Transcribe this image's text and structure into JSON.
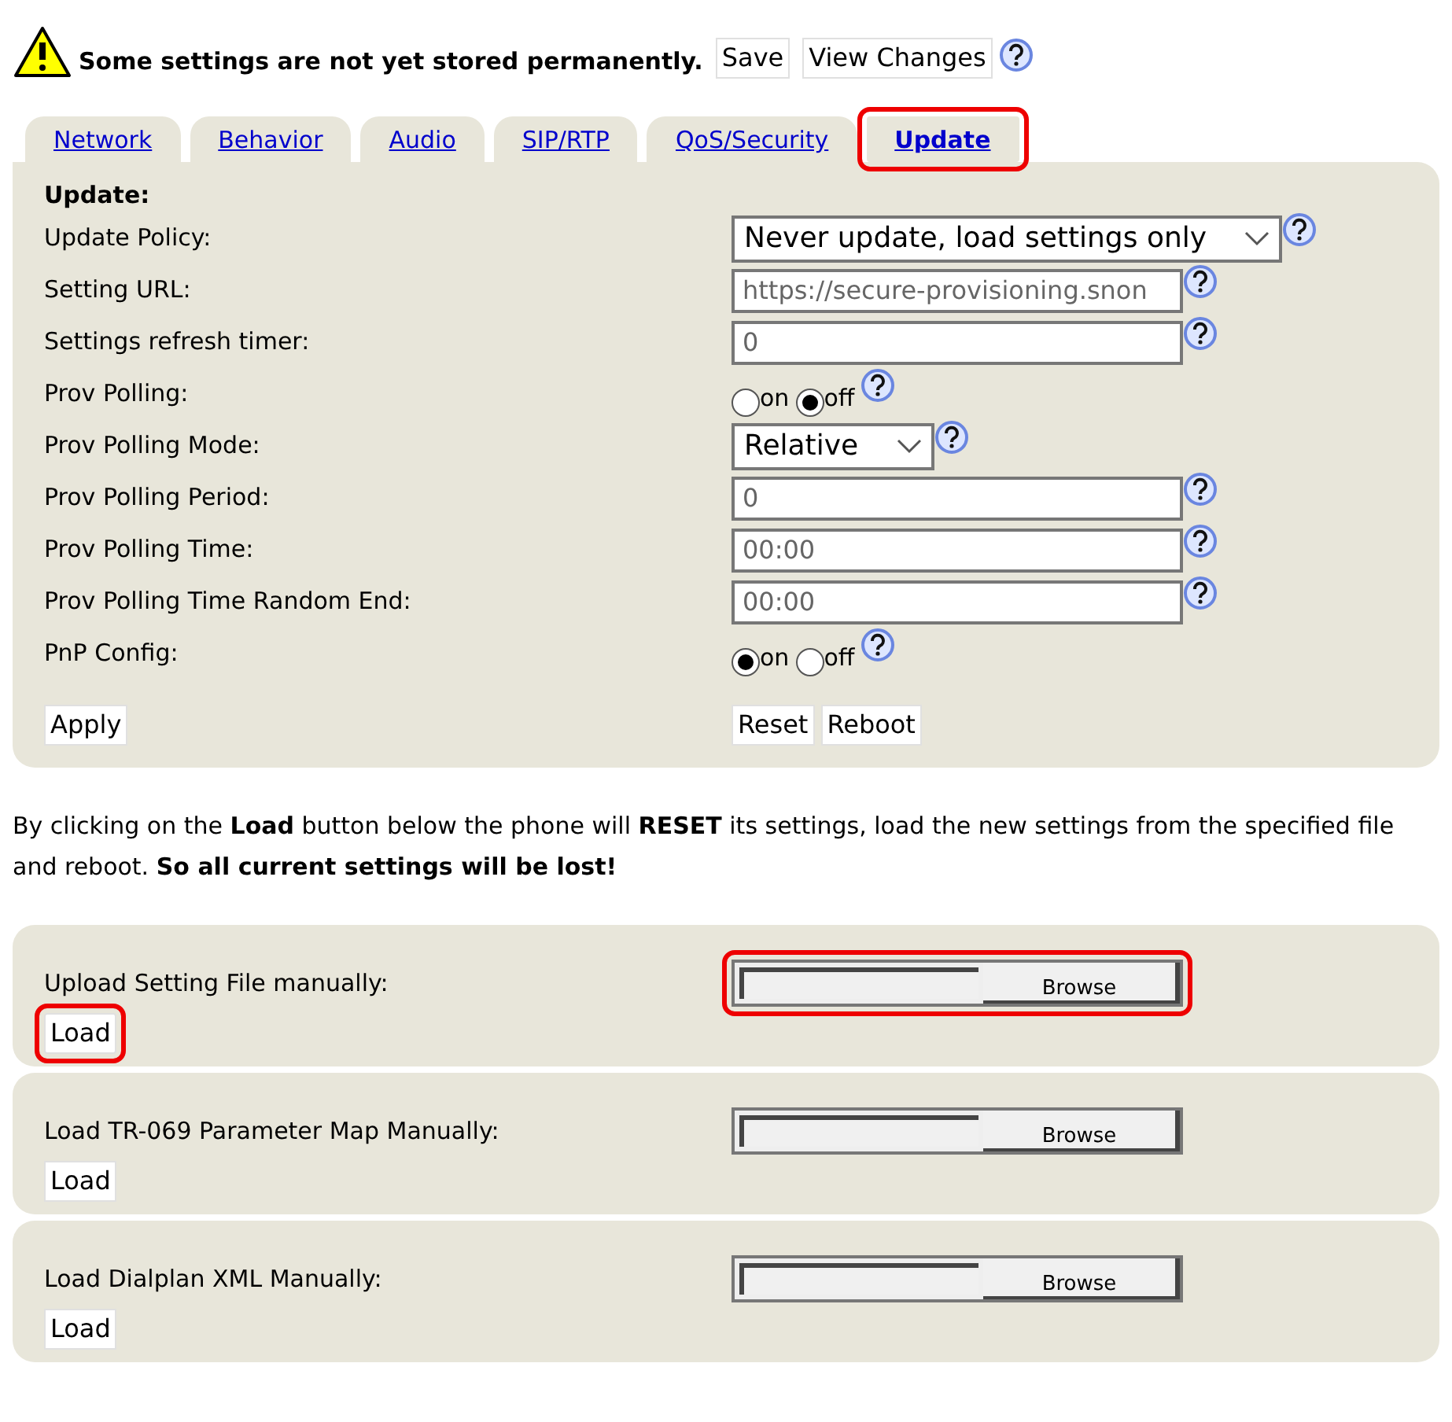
{
  "notice": {
    "text": "Some settings are not yet stored permanently.",
    "buttons": [
      "Save",
      "View Changes"
    ]
  },
  "tabs": [
    {
      "label": "Network",
      "selected": false,
      "highlighted": false
    },
    {
      "label": "Behavior",
      "selected": false,
      "highlighted": false
    },
    {
      "label": "Audio",
      "selected": false,
      "highlighted": false
    },
    {
      "label": "SIP/RTP",
      "selected": false,
      "highlighted": false
    },
    {
      "label": "QoS/Security",
      "selected": false,
      "highlighted": false
    },
    {
      "label": "Update",
      "selected": true,
      "highlighted": true
    }
  ],
  "section_title": "Update:",
  "fields": [
    {
      "kind": "select",
      "label": "Update Policy:",
      "value": "Never update, load settings only"
    },
    {
      "kind": "text",
      "label": "Setting URL:",
      "value": "https://secure-provisioning.snon"
    },
    {
      "kind": "text",
      "label": "Settings refresh timer:",
      "value": "0"
    },
    {
      "kind": "radio",
      "label": "Prov Polling:",
      "options": [
        {
          "label": "on",
          "selected": false
        },
        {
          "label": "off",
          "selected": true
        }
      ]
    },
    {
      "kind": "select",
      "label": "Prov Polling Mode:",
      "value": "Relative"
    },
    {
      "kind": "text",
      "label": "Prov Polling Period:",
      "value": "0"
    },
    {
      "kind": "text",
      "label": "Prov Polling Time:",
      "value": "00:00"
    },
    {
      "kind": "text",
      "label": "Prov Polling Time Random End:",
      "value": "00:00"
    },
    {
      "kind": "radio",
      "label": "PnP Config:",
      "options": [
        {
          "label": "on",
          "selected": true
        },
        {
          "label": "off",
          "selected": false
        }
      ]
    }
  ],
  "apply_button": "Apply",
  "right_buttons": [
    "Reset",
    "Reboot"
  ],
  "warning_text": "By clicking on the **Load** button below the phone will **RESET** its settings, load the new settings from the specified file and reboot. **So all current settings will be lost!**",
  "uploads": [
    {
      "label": "Upload Setting File manually:",
      "browse": "Browse",
      "action": "Load",
      "highlighted": true
    },
    {
      "label": "Load TR-069 Parameter Map Manually:",
      "browse": "Browse",
      "action": "Load",
      "highlighted": false
    },
    {
      "label": "Load Dialplan XML Manually:",
      "browse": "Browse",
      "action": "Load",
      "highlighted": false
    }
  ]
}
